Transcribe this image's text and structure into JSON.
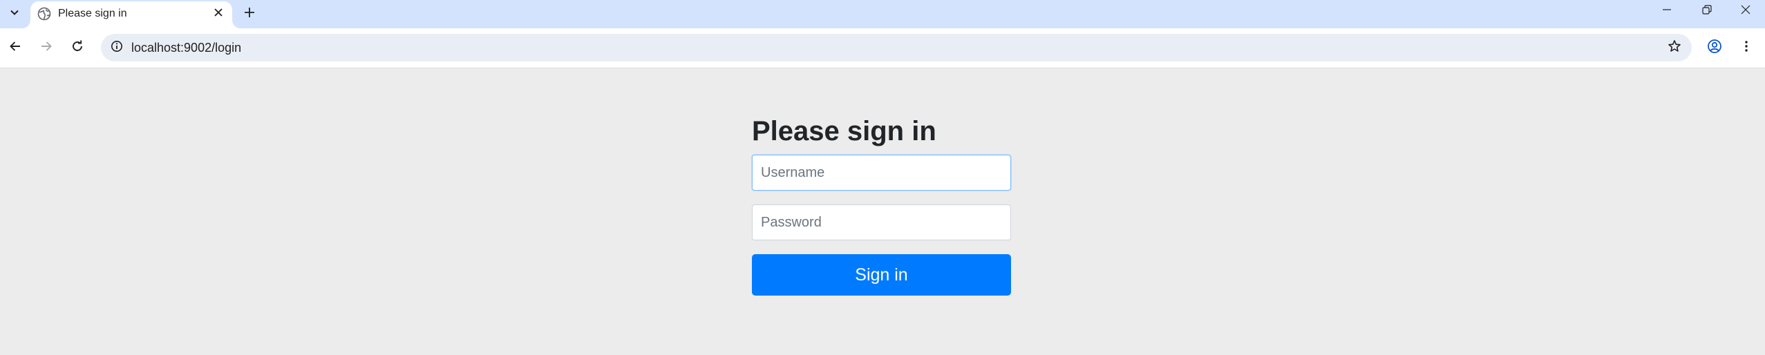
{
  "browser": {
    "tab": {
      "title": "Please sign in",
      "favicon": "globe-icon"
    },
    "new_tab_icon": "plus-icon",
    "window_controls": [
      "minimize-icon",
      "restore-icon",
      "close-icon"
    ],
    "address_bar": {
      "url": "localhost:9002/login",
      "site_info_icon": "info-icon",
      "bookmark_icon": "star-icon"
    },
    "toolbar_icons": [
      "back-arrow-icon",
      "forward-arrow-icon",
      "reload-icon",
      "profile-icon",
      "kebab-menu-icon"
    ]
  },
  "login_form": {
    "heading": "Please sign in",
    "username_placeholder": "Username",
    "username_value": "",
    "password_placeholder": "Password",
    "password_value": "",
    "submit_label": "Sign in"
  },
  "colors": {
    "page_background": "#ececec",
    "primary_button": "#007bff",
    "tabstrip_background": "#d3e3fd",
    "omnibox_background": "#e9eef6"
  }
}
